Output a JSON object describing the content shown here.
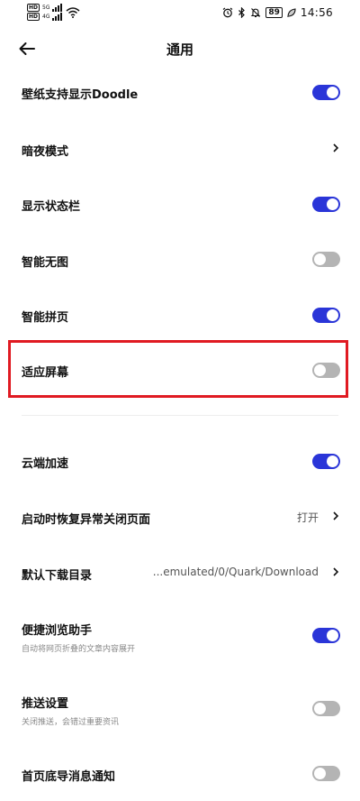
{
  "status_bar": {
    "sim1_badge": "HD",
    "sim1_network": "5G",
    "sim2_badge": "HD",
    "sim2_network": "4G",
    "battery": "89",
    "time": "14:56",
    "icons": [
      "wifi-icon",
      "alarm-icon",
      "bluetooth-icon",
      "mute-icon",
      "battery-icon",
      "leaf-icon"
    ]
  },
  "header": {
    "title": "通用",
    "back_icon": "arrow-left-icon"
  },
  "settings": [
    {
      "label": "壁纸支持显示Doodle",
      "control": "toggle",
      "state": "on"
    },
    {
      "label": "暗夜模式",
      "control": "chevron"
    },
    {
      "label": "显示状态栏",
      "control": "toggle",
      "state": "on"
    },
    {
      "label": "智能无图",
      "control": "toggle",
      "state": "off"
    },
    {
      "label": "智能拼页",
      "control": "toggle",
      "state": "on"
    },
    {
      "label": "适应屏幕",
      "control": "toggle",
      "state": "off",
      "highlighted": true
    },
    {
      "label": "云端加速",
      "control": "toggle",
      "state": "on"
    },
    {
      "label": "启动时恢复异常关闭页面",
      "control": "chevron",
      "value": "打开"
    },
    {
      "label": "默认下载目录",
      "control": "chevron",
      "value": "...emulated/0/Quark/Download"
    },
    {
      "label": "便捷浏览助手",
      "sublabel": "自动将网页折叠的文章内容展开",
      "control": "toggle",
      "state": "on"
    },
    {
      "label": "推送设置",
      "sublabel": "关闭推送，会错过重要资讯",
      "control": "toggle",
      "state": "off"
    },
    {
      "label": "首页底导消息通知",
      "control": "toggle",
      "state": "off"
    }
  ],
  "colors": {
    "toggle_on": "#2a35d8",
    "toggle_off": "#b4b4b4",
    "highlight": "#e01a22"
  }
}
